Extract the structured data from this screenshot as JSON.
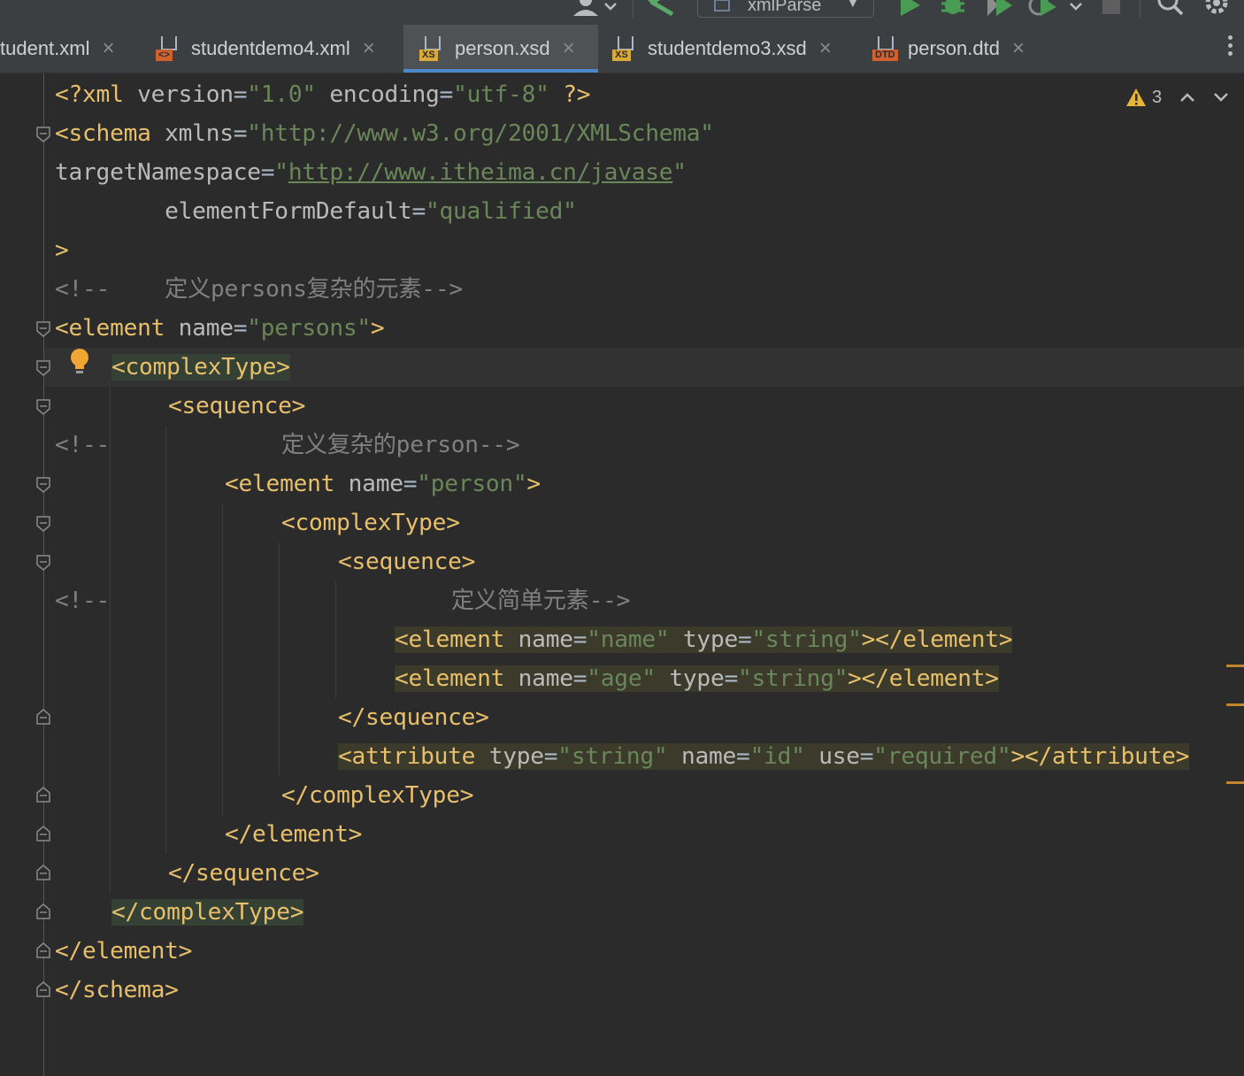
{
  "toolbar": {
    "run_config_label": "xmlParse",
    "icons": [
      "user-icon",
      "build-hammer-icon",
      "run-icon",
      "debug-icon",
      "coverage-icon",
      "profile-icon",
      "stop-icon",
      "search-icon",
      "settings-icon"
    ]
  },
  "tabs": [
    {
      "label": "tudent.xml",
      "badge": "",
      "badge_color": "#a9b7c6",
      "active": false
    },
    {
      "label": "studentdemo4.xml",
      "badge": "<>",
      "badge_color": "#d0612e",
      "active": false
    },
    {
      "label": "person.xsd",
      "badge": "XS",
      "badge_color": "#d9a93a",
      "active": true
    },
    {
      "label": "studentdemo3.xsd",
      "badge": "XS",
      "badge_color": "#d9a93a",
      "active": false
    },
    {
      "label": "person.dtd",
      "badge": "DTD",
      "badge_color": "#d0612e",
      "active": false
    }
  ],
  "editor": {
    "inspection_count": "3",
    "lines": {
      "l1": {
        "p1": "<?xml ",
        "p2": "version",
        "p3": "=",
        "p4": "\"1.0\"",
        "p5": " ",
        "p6": "encoding",
        "p7": "=",
        "p8": "\"utf-8\"",
        "p9": " ?>"
      },
      "l2": {
        "p1": "<schema ",
        "p2": "xmlns",
        "p3": "=",
        "p4": "\"http://www.w3.org/2001/XMLSchema\""
      },
      "l3": {
        "p1": "targetNamespace",
        "p2": "=",
        "p3": "\"",
        "p4": "http://www.itheima.cn/javase",
        "p5": "\""
      },
      "l4": {
        "p1": "        ",
        "p2": "elementFormDefault",
        "p3": "=",
        "p4": "\"qualified\""
      },
      "l5": {
        "p1": ">"
      },
      "l6": {
        "p1": "<!--    定义persons复杂的元素-->"
      },
      "l7": {
        "p1": "<element ",
        "p2": "name",
        "p3": "=",
        "p4": "\"persons\"",
        "p5": ">"
      },
      "l8": {
        "p1": "<complexType>"
      },
      "l9": {
        "p1": "<sequence>"
      },
      "l10": {
        "p1": "<!--",
        "p2": "定义复杂的person-->"
      },
      "l11": {
        "p1": "<element ",
        "p2": "name",
        "p3": "=",
        "p4": "\"person\"",
        "p5": ">"
      },
      "l12": {
        "p1": "<complexType>"
      },
      "l13": {
        "p1": "<sequence>"
      },
      "l14": {
        "p1": "<!--",
        "p2": "定义简单元素-->"
      },
      "l15": {
        "p1": "<element ",
        "p2": "name",
        "p3": "=",
        "p4": "\"name\"",
        "p5": " ",
        "p6": "type",
        "p7": "=",
        "p8": "\"string\"",
        "p9": "></element>"
      },
      "l16": {
        "p1": "<element ",
        "p2": "name",
        "p3": "=",
        "p4": "\"age\"",
        "p5": " ",
        "p6": "type",
        "p7": "=",
        "p8": "\"string\"",
        "p9": "></element>"
      },
      "l17": {
        "p1": "</sequence>"
      },
      "l18": {
        "p1": "<attribute ",
        "p2": "type",
        "p3": "=",
        "p4": "\"string\"",
        "p5": " ",
        "p6": "name",
        "p7": "=",
        "p8": "\"id\"",
        "p9": " ",
        "p10": "use",
        "p11": "=",
        "p12": "\"required\"",
        "p13": "></attribute>"
      },
      "l19": {
        "p1": "</complexType>"
      },
      "l20": {
        "p1": "</element>"
      },
      "l21": {
        "p1": "</sequence>"
      },
      "l22": {
        "p1": "</complexType>"
      },
      "l23": {
        "p1": "</element>"
      },
      "l24": {
        "p1": "</schema>"
      }
    }
  },
  "colors": {
    "tag": "#e8bf6a",
    "attribute": "#bababa",
    "value": "#6a8759",
    "comment": "#808080",
    "accent": "#4a88c7",
    "warning": "#e5b53b"
  }
}
